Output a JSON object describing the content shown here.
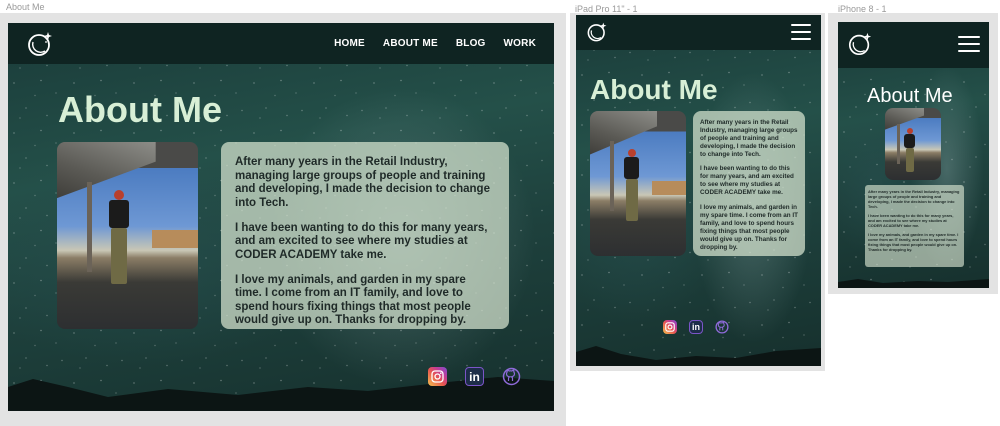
{
  "artboards": {
    "desktop": "About Me",
    "tablet": "iPad Pro 11\" - 1",
    "phone": "iPhone 8 - 1"
  },
  "nav": {
    "items": [
      "HOME",
      "ABOUT ME",
      "BLOG",
      "WORK"
    ]
  },
  "page": {
    "heading": "About Me",
    "bio": [
      "After many years in the Retail Industry, managing large groups of people and training and developing, I made the decision to change into Tech.",
      "I have been wanting to do this for many years, and am excited to see where my studies at CODER ACADEMY take me.",
      "I love my animals, and garden in my spare time. I come from an IT family, and love to spend hours fixing things that most people would give up on. Thanks for dropping by."
    ]
  },
  "social": {
    "icons": [
      "instagram-icon",
      "linkedin-icon",
      "github-icon"
    ],
    "linkedin_text": "in"
  },
  "colors": {
    "navbar": "#0f2422",
    "heading": "#d8efd6",
    "card": "#d7e4d0",
    "linkedin_border": "#7b55c8"
  }
}
